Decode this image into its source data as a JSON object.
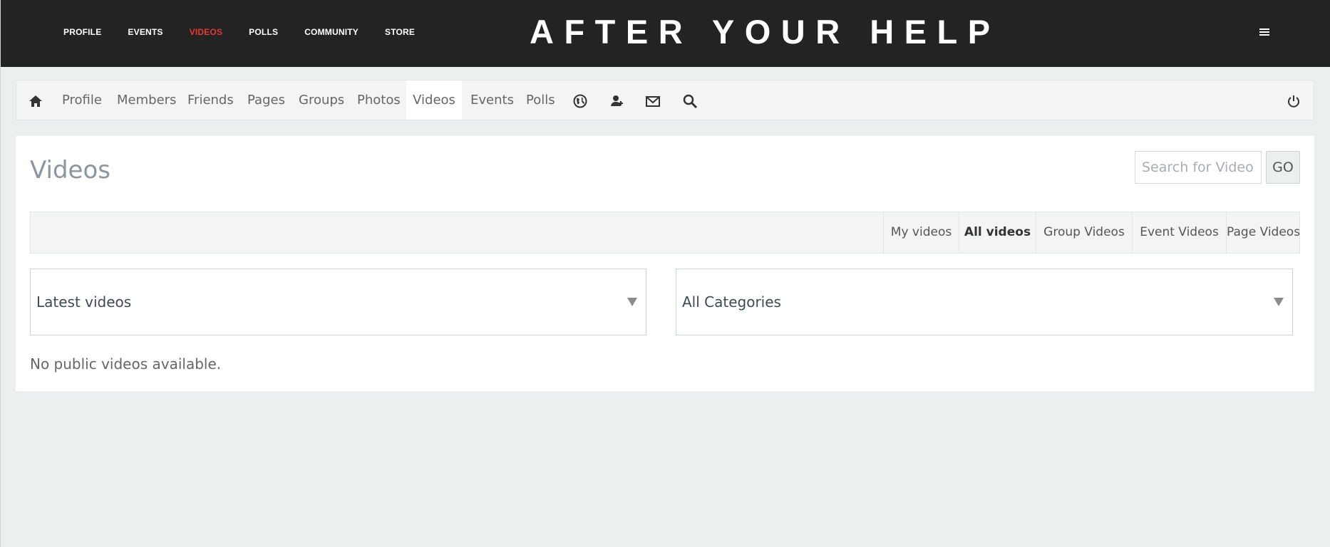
{
  "header": {
    "nav": [
      {
        "label": "PROFILE",
        "active": false
      },
      {
        "label": "EVENTS",
        "active": false
      },
      {
        "label": "VIDEOS",
        "active": true
      },
      {
        "label": "POLLS",
        "active": false
      },
      {
        "label": "COMMUNITY",
        "active": false
      },
      {
        "label": "STORE",
        "active": false
      }
    ],
    "site_title": "AFTER YOUR HELP",
    "menu_icon": "hamburger-icon"
  },
  "toolbar": {
    "home_icon": "home-icon",
    "items": [
      {
        "label": "Profile"
      },
      {
        "label": "Members"
      },
      {
        "label": "Friends"
      },
      {
        "label": "Pages"
      },
      {
        "label": "Groups"
      },
      {
        "label": "Photos"
      },
      {
        "label": "Videos",
        "active": true
      },
      {
        "label": "Events"
      },
      {
        "label": "Polls"
      }
    ],
    "icons": [
      "globe-icon",
      "friend-requests-icon",
      "mail-icon",
      "search-icon"
    ],
    "power_icon": "power-icon"
  },
  "main": {
    "title": "Videos",
    "search": {
      "placeholder": "Search for Videos",
      "button_label": "GO"
    },
    "tabs": [
      {
        "label": "My videos",
        "active": false
      },
      {
        "label": "All videos",
        "active": true
      },
      {
        "label": "Group Videos",
        "active": false
      },
      {
        "label": "Event Videos",
        "active": false
      },
      {
        "label": "Page Videos",
        "active": false
      }
    ],
    "sort_select": {
      "value": "Latest videos"
    },
    "category_select": {
      "value": "All Categories"
    },
    "empty_message": "No public videos available."
  },
  "colors": {
    "header_bg": "#232323",
    "active_nav": "#e53935",
    "page_bg": "#ebeff0"
  }
}
